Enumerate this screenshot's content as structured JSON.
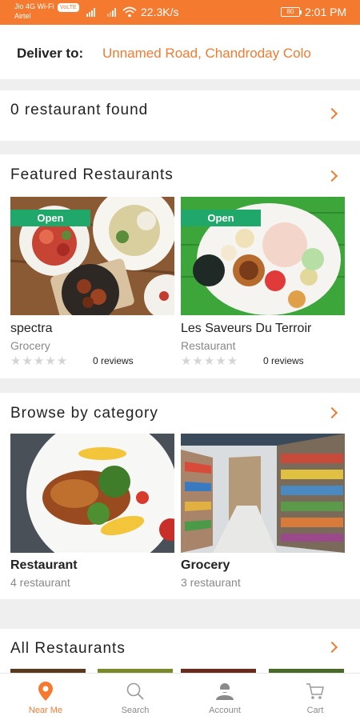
{
  "status_bar": {
    "carrier_line1": "Jio 4G Wi-Fi",
    "volte": "VoLTE",
    "carrier_line2": "Airtel",
    "speed": "22.3K/s",
    "battery": "80",
    "time": "2:01 PM"
  },
  "deliver": {
    "label": "Deliver to:",
    "address": "Unnamed Road, Chandroday Colo"
  },
  "found": {
    "text": "0 restaurant found"
  },
  "featured": {
    "title": "Featured Restaurants",
    "cards": [
      {
        "badge": "Open",
        "name": "spectra",
        "type": "Grocery",
        "stars": "★★★★★",
        "reviews": "0 reviews"
      },
      {
        "badge": "Open",
        "name": "Les Saveurs Du Terroir",
        "type": "Restaurant",
        "stars": "★★★★★",
        "reviews": "0 reviews"
      }
    ]
  },
  "browse": {
    "title": "Browse by category",
    "categories": [
      {
        "name": "Restaurant",
        "count": "4 restaurant"
      },
      {
        "name": "Grocery",
        "count": "3 restaurant"
      }
    ]
  },
  "all_restaurants": {
    "title": "All Restaurants"
  },
  "tabs": [
    {
      "label": "Near Me",
      "icon": "location-pin-icon",
      "active": true
    },
    {
      "label": "Search",
      "icon": "search-icon",
      "active": false
    },
    {
      "label": "Account",
      "icon": "account-icon",
      "active": false
    },
    {
      "label": "Cart",
      "icon": "cart-icon",
      "active": false
    }
  ],
  "colors": {
    "accent": "#f47a30",
    "open_badge": "#20a86b"
  }
}
